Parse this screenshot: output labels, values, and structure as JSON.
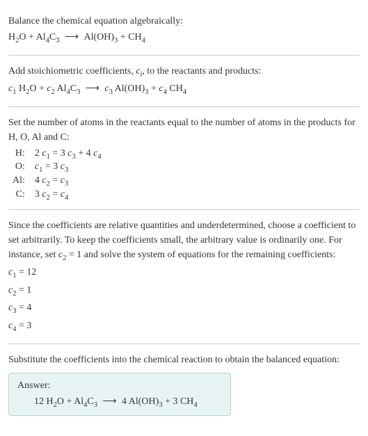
{
  "intro": {
    "title": "Balance the chemical equation algebraically:",
    "eq_lhs1": "H",
    "eq_lhs1_sub": "2",
    "eq_lhs1b": "O + Al",
    "eq_lhs1b_sub": "4",
    "eq_lhs1c": "C",
    "eq_lhs1c_sub": "3",
    "arrow": " ⟶ ",
    "eq_rhs1": "Al(OH)",
    "eq_rhs1_sub": "3",
    "eq_rhs1b": " + CH",
    "eq_rhs1b_sub": "4"
  },
  "stoich": {
    "text": "Add stoichiometric coefficients, ",
    "ci": "c",
    "ci_sub": "i",
    "text2": ", to the reactants and products:",
    "c1": "c",
    "c1_sub": "1",
    "sp1": " H",
    "sp1_sub": "2",
    "sp1b": "O + ",
    "c2": "c",
    "c2_sub": "2",
    "sp2": " Al",
    "sp2_sub": "4",
    "sp2b": "C",
    "sp2b_sub": "3",
    "arrow": " ⟶ ",
    "c3": "c",
    "c3_sub": "3",
    "sp3": " Al(OH)",
    "sp3_sub": "3",
    "sp3b": " + ",
    "c4": "c",
    "c4_sub": "4",
    "sp4": " CH",
    "sp4_sub": "4"
  },
  "atoms": {
    "text": "Set the number of atoms in the reactants equal to the number of atoms in the products for H, O, Al and C:",
    "rows": [
      {
        "label": "H:",
        "eq_pre": "2 ",
        "c1": "c",
        "c1s": "1",
        "mid": " = 3 ",
        "c2": "c",
        "c2s": "3",
        "mid2": " + 4 ",
        "c3": "c",
        "c3s": "4"
      },
      {
        "label": "O:",
        "eq_pre": "",
        "c1": "c",
        "c1s": "1",
        "mid": " = 3 ",
        "c2": "c",
        "c2s": "3",
        "mid2": "",
        "c3": "",
        "c3s": ""
      },
      {
        "label": "Al:",
        "eq_pre": "4 ",
        "c1": "c",
        "c1s": "2",
        "mid": " = ",
        "c2": "c",
        "c2s": "3",
        "mid2": "",
        "c3": "",
        "c3s": ""
      },
      {
        "label": "C:",
        "eq_pre": "3 ",
        "c1": "c",
        "c1s": "2",
        "mid": " = ",
        "c2": "c",
        "c2s": "4",
        "mid2": "",
        "c3": "",
        "c3s": ""
      }
    ]
  },
  "solve": {
    "text1": "Since the coefficients are relative quantities and underdetermined, choose a coefficient to set arbitrarily. To keep the coefficients small, the arbitrary value is ordinarily one. For instance, set ",
    "cv": "c",
    "cvs": "2",
    "text2": " = 1 and solve the system of equations for the remaining coefficients:",
    "lines": [
      {
        "c": "c",
        "cs": "1",
        "val": " = 12"
      },
      {
        "c": "c",
        "cs": "2",
        "val": " = 1"
      },
      {
        "c": "c",
        "cs": "3",
        "val": " = 4"
      },
      {
        "c": "c",
        "cs": "4",
        "val": " = 3"
      }
    ]
  },
  "subst": {
    "text": "Substitute the coefficients into the chemical reaction to obtain the balanced equation:"
  },
  "answer": {
    "label": "Answer:",
    "p1": "12 H",
    "p1s": "2",
    "p2": "O + Al",
    "p2s": "4",
    "p3": "C",
    "p3s": "3",
    "arrow": " ⟶ ",
    "p4": "4 Al(OH)",
    "p4s": "3",
    "p5": " + 3 CH",
    "p5s": "4"
  },
  "chart_data": {
    "type": "table",
    "title": "Balanced chemical equation coefficients",
    "reaction_unbalanced": "H2O + Al4C3 → Al(OH)3 + CH4",
    "atom_balance_equations": {
      "H": "2 c1 = 3 c3 + 4 c4",
      "O": "c1 = 3 c3",
      "Al": "4 c2 = c3",
      "C": "3 c2 = c4"
    },
    "coefficients": {
      "c1": 12,
      "c2": 1,
      "c3": 4,
      "c4": 3
    },
    "reaction_balanced": "12 H2O + Al4C3 → 4 Al(OH)3 + 3 CH4"
  }
}
